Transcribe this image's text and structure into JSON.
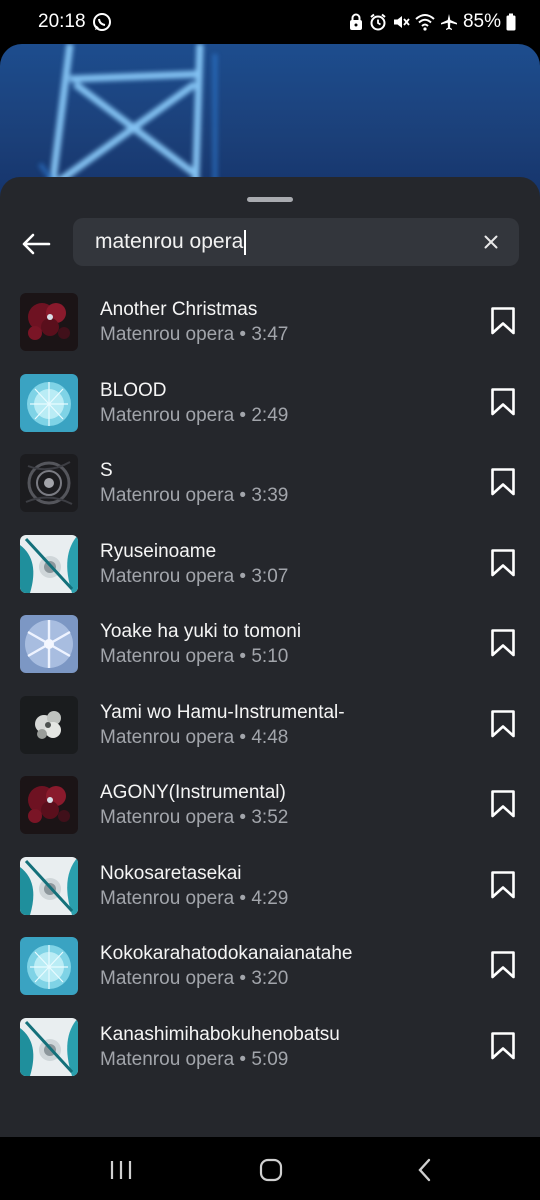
{
  "status_bar": {
    "time": "20:18",
    "battery": "85%",
    "icons": [
      "whatsapp-icon",
      "lock-icon",
      "alarm-icon",
      "mute-icon",
      "wifi-icon",
      "airplane-icon",
      "battery-icon"
    ]
  },
  "search": {
    "value": "matenrou opera"
  },
  "colors": {
    "sheet_bg": "#25272c",
    "search_bg": "#33363c",
    "subtitle": "#a2a5ab",
    "backdrop": "#1d4d8e"
  },
  "tracks": [
    {
      "title": "Another Christmas",
      "subtitle": "Matenrou opera • 3:47",
      "art": "dark-red-flower"
    },
    {
      "title": "BLOOD",
      "subtitle": "Matenrou opera • 2:49",
      "art": "blue-crystal-orb"
    },
    {
      "title": "S",
      "subtitle": "Matenrou opera • 3:39",
      "art": "dark-gray-swirl"
    },
    {
      "title": "Ryuseinoame",
      "subtitle": "Matenrou opera • 3:07",
      "art": "white-teal-figure"
    },
    {
      "title": "Yoake ha yuki to tomoni",
      "subtitle": "Matenrou opera • 5:10",
      "art": "blue-snowflake"
    },
    {
      "title": "Yami wo Hamu-Instrumental-",
      "subtitle": "Matenrou opera • 4:48",
      "art": "dark-white-flower"
    },
    {
      "title": "AGONY(Instrumental)",
      "subtitle": "Matenrou opera • 3:52",
      "art": "dark-red-flower"
    },
    {
      "title": "Nokosaretasekai",
      "subtitle": "Matenrou opera • 4:29",
      "art": "white-teal-figure"
    },
    {
      "title": "Kokokarahatodokanaianatahe",
      "subtitle": "Matenrou opera • 3:20",
      "art": "blue-crystal-orb"
    },
    {
      "title": "Kanashimihabokuhenobatsu",
      "subtitle": "Matenrou opera • 5:09",
      "art": "white-teal-figure"
    }
  ]
}
